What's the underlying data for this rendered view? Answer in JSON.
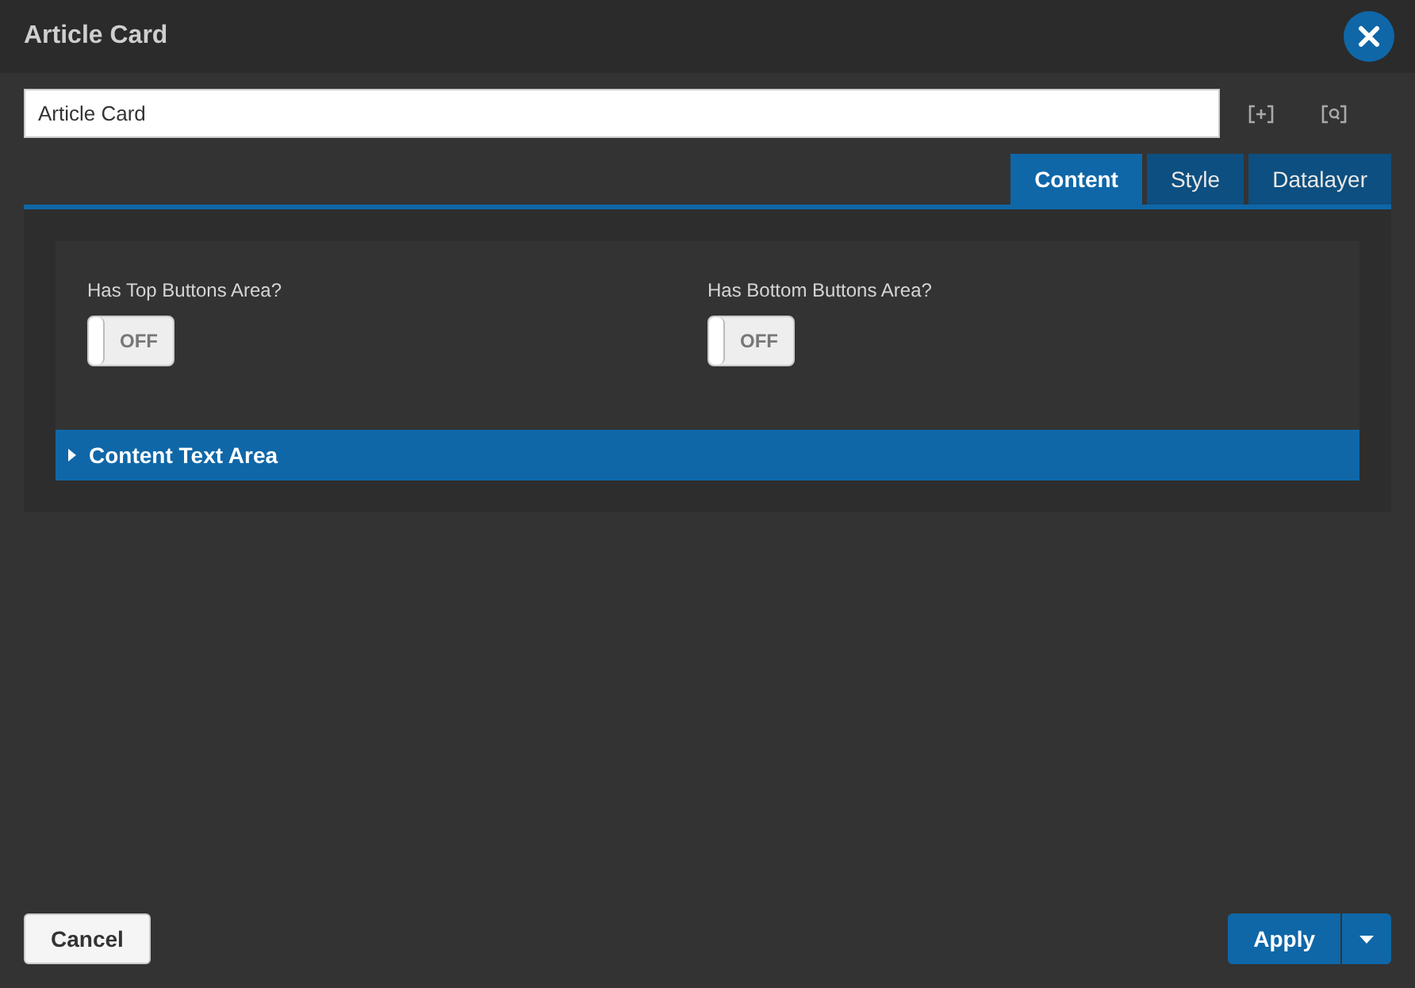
{
  "window": {
    "title": "Article Card"
  },
  "name_field": {
    "value": "Article Card"
  },
  "tabs": [
    {
      "label": "Content",
      "selected": true
    },
    {
      "label": "Style",
      "selected": false
    },
    {
      "label": "Datalayer",
      "selected": false
    }
  ],
  "toggles": [
    {
      "label": "Has Top Buttons Area?",
      "on": false,
      "state_text": "OFF"
    },
    {
      "label": "Has Bottom Buttons Area?",
      "on": false,
      "state_text": "OFF"
    }
  ],
  "section": {
    "title": "Content Text Area",
    "expanded": false
  },
  "buttons": {
    "cancel": "Cancel",
    "apply": "Apply"
  }
}
